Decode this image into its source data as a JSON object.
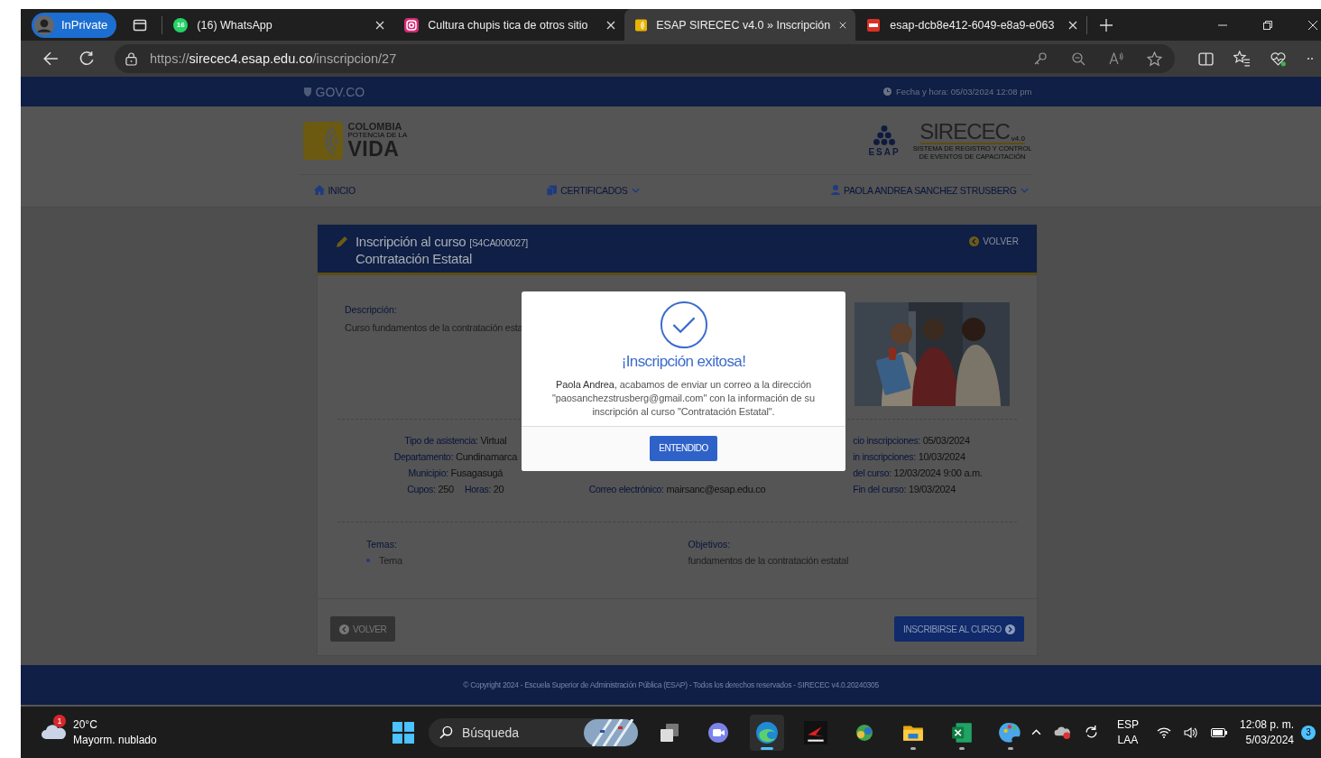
{
  "browser": {
    "profile": "InPrivate",
    "tabs": [
      {
        "kind": "whatsapp",
        "badge": "16",
        "title": "(16) WhatsApp",
        "selected": false
      },
      {
        "kind": "instagram",
        "title": "Cultura chupis tica de otros sitio",
        "selected": false
      },
      {
        "kind": "esap",
        "title": "ESAP SIRECEC v4.0 » Inscripción",
        "selected": true
      },
      {
        "kind": "pdf",
        "title": "esap-dcb8e412-6049-e8a9-e063",
        "selected": false
      }
    ],
    "address": {
      "scheme": "https://",
      "host": "sirecec4.esap.edu.co",
      "path": "/inscripcion/27"
    }
  },
  "gov_bar": {
    "logo": "GOV.CO",
    "datetime": "Fecha y hora: 05/03/2024 12:08 pm"
  },
  "brand": {
    "country": "COLOMBIA",
    "tagline": "POTENCIA DE LA",
    "word": "VIDA"
  },
  "system": {
    "esap": "ESAP",
    "name": "SIRECEC",
    "version": "v4.0",
    "subtitle": "SISTEMA DE REGISTRO Y CONTROL",
    "subtitle_2": "DE EVENTOS DE CAPACITACIÓN"
  },
  "nav": [
    {
      "label": "INICIO",
      "dropdown": false
    },
    {
      "label": "CERTIFICADOS",
      "dropdown": true
    },
    {
      "label": "PAOLA ANDREA SANCHEZ STRUSBERG",
      "dropdown": true
    }
  ],
  "course": {
    "heading": "Inscripción al curso",
    "code": "[S4CA000027]",
    "name": "Contratación Estatal",
    "back": "VOLVER",
    "description_label": "Descripción:",
    "description": "Curso fundamentos de la contratación esta",
    "details": [
      {
        "lines": [
          [
            {
              "label": "Tipo de asistencia:",
              "value": "Virtual"
            }
          ],
          [
            {
              "label": "Departamento:",
              "value": "Cundinamarca"
            }
          ],
          [
            {
              "label": "Municipio:",
              "value": "Fusagasugá"
            }
          ],
          [
            {
              "label": "Cupos:",
              "value": "250"
            },
            {
              "label": "Horas:",
              "value": "20"
            }
          ]
        ]
      },
      {
        "lines": [
          [
            {
              "label": "Correo electrónico:",
              "value": "mairsanc@esap.edu.co"
            }
          ]
        ]
      },
      {
        "lines": [
          [
            {
              "label": "cio inscripciones:",
              "value": "05/03/2024"
            }
          ],
          [
            {
              "label": "in inscripciones:",
              "value": "10/03/2024"
            }
          ],
          [
            {
              "label": "del curso:",
              "value": "12/03/2024 9:00 a.m."
            }
          ],
          [
            {
              "label": "Fin del curso:",
              "value": "19/03/2024"
            }
          ]
        ]
      }
    ],
    "topics": {
      "label": "Temas:",
      "items": [
        "Tema"
      ]
    },
    "objectives": {
      "label": "Objetivos:",
      "text": "fundamentos de la contratación estatal"
    },
    "back_button": "VOLVER",
    "enroll_button": "INSCRIBIRSE AL CURSO"
  },
  "modal": {
    "title": "¡Inscripción exitosa!",
    "message": "**Paola Andrea**, acabamos de enviar un correo a la dirección \"paosanchezstrusberg@gmail.com\" con la información de su inscripción al curso \"Contratación Estatal\".",
    "button": "ENTENDIDO"
  },
  "footer": "© Copyright 2024 - Escuela Superior de Administración Pública (ESAP) - Todos los derechos reservados - SIRECEC v4.0.20240305",
  "taskbar": {
    "weather": {
      "badge": "1",
      "temp": "20°C",
      "text": "Mayorm. nublado"
    },
    "search": "Búsqueda",
    "apps": [
      {
        "kind": "taskview",
        "active": false,
        "running": false
      },
      {
        "kind": "chat",
        "active": false,
        "running": false
      },
      {
        "kind": "edge",
        "active": true,
        "running": true
      },
      {
        "kind": "redapp",
        "active": false,
        "running": false
      },
      {
        "kind": "network",
        "active": false,
        "running": false
      },
      {
        "kind": "folder",
        "active": false,
        "running": true
      },
      {
        "kind": "excel",
        "active": false,
        "running": true
      },
      {
        "kind": "paint",
        "active": false,
        "running": true
      }
    ],
    "language": "ESP",
    "layout": "LAA",
    "time": "12:08 p. m.",
    "date": "5/03/2024",
    "notifications": "3"
  }
}
